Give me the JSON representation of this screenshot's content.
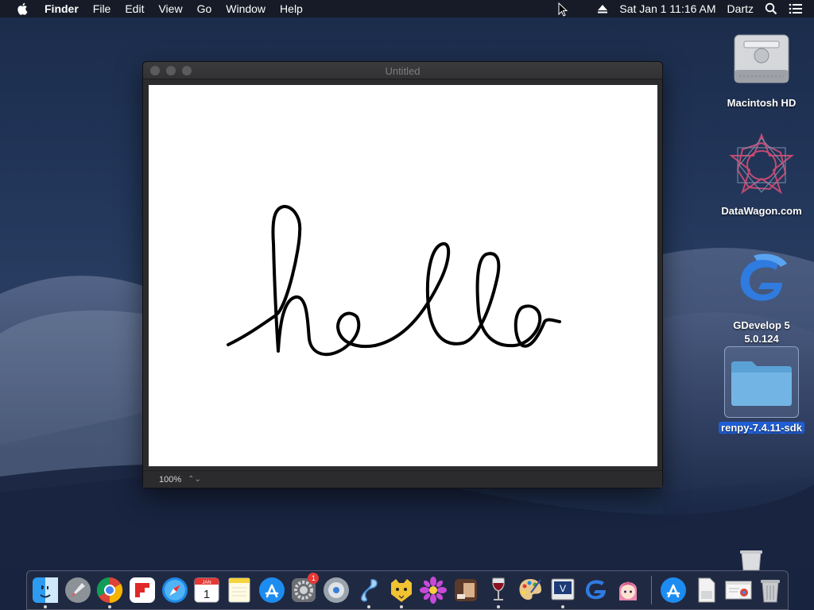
{
  "menubar": {
    "items": [
      "Finder",
      "File",
      "Edit",
      "View",
      "Go",
      "Window",
      "Help"
    ],
    "datetime": "Sat Jan 1  11:16 AM",
    "user": "Dartz"
  },
  "window": {
    "title": "Untitled",
    "zoom": "100%",
    "zoom_stepper": "⌃⌄",
    "drawing_word": "hello"
  },
  "desktop": {
    "icons": [
      {
        "label": "Macintosh HD"
      },
      {
        "label": "DataWagon.com"
      },
      {
        "label": "GDevelop 5 5.0.124"
      },
      {
        "label": "renpy-7.4.11-sdk"
      }
    ]
  },
  "dock": {
    "apps": [
      {
        "name": "finder-icon",
        "running": true
      },
      {
        "name": "launchpad-icon",
        "running": false
      },
      {
        "name": "chrome-icon",
        "running": true
      },
      {
        "name": "flipboard-icon",
        "running": false
      },
      {
        "name": "safari-icon",
        "running": false
      },
      {
        "name": "calendar-icon",
        "running": false,
        "date_month": "JAN",
        "date_day": "1"
      },
      {
        "name": "notes-icon",
        "running": false
      },
      {
        "name": "app-store-icon",
        "running": false
      },
      {
        "name": "system-preferences-icon",
        "running": false,
        "badge": "1"
      },
      {
        "name": "disk-utility-icon",
        "running": false
      },
      {
        "name": "scribble-app-icon",
        "running": true
      },
      {
        "name": "cheetah-icon",
        "running": true
      },
      {
        "name": "flower-icon",
        "running": false
      },
      {
        "name": "brown-box-icon",
        "running": false
      },
      {
        "name": "wine-icon",
        "running": true
      },
      {
        "name": "paint-palette-icon",
        "running": false
      },
      {
        "name": "vim-icon",
        "running": true
      },
      {
        "name": "gdevelop-icon",
        "running": false
      },
      {
        "name": "anime-girl-icon",
        "running": false
      },
      {
        "name": "app-store-icon-2",
        "running": false
      },
      {
        "name": "file-doc-icon",
        "running": false
      },
      {
        "name": "chrome-window-icon",
        "running": false
      },
      {
        "name": "trash-icon",
        "running": false
      }
    ]
  },
  "colors": {
    "selection": "#1f5fd6",
    "badge": "#e53935"
  }
}
